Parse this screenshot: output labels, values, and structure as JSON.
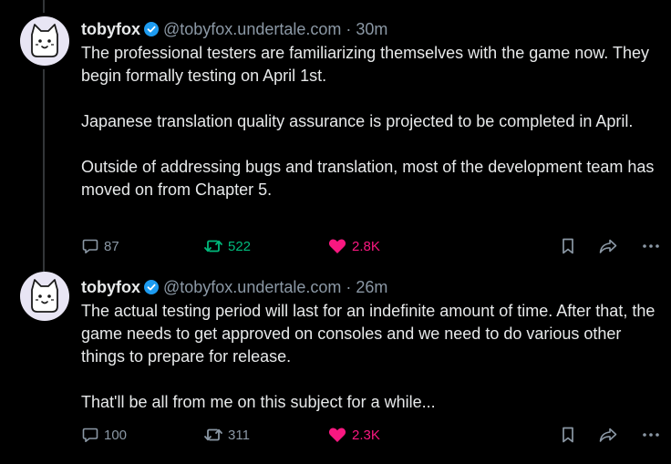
{
  "colors": {
    "background": "#000000",
    "text": "#e7e9ea",
    "muted": "#8b98a5",
    "verified": "#1d9bf0",
    "retweet_active": "#00ba7c",
    "like_active": "#f91880"
  },
  "posts": [
    {
      "author": {
        "name": "tobyfox",
        "handle": "@tobyfox.undertale.com",
        "verified": true,
        "avatar_icon": "white-dog-avatar-icon"
      },
      "separator": "·",
      "time": "30m",
      "text": "The professional testers are familiarizing themselves with the game now. They begin formally testing on April 1st.\n\nJapanese translation quality assurance is projected to be completed in April.\n\nOutside of addressing bugs and translation, most of the development team has moved on from Chapter 5.",
      "stats": {
        "replies": "87",
        "reposts": "522",
        "likes": "2.8K",
        "reposted": true,
        "liked": true
      }
    },
    {
      "author": {
        "name": "tobyfox",
        "handle": "@tobyfox.undertale.com",
        "verified": true,
        "avatar_icon": "white-dog-avatar-icon"
      },
      "separator": "·",
      "time": "26m",
      "text": "The actual testing period will last for an indefinite amount of time. After that, the game needs to get approved on consoles and we need to do various other things to prepare for release.\n\nThat'll be all from me on this subject for a while...",
      "stats": {
        "replies": "100",
        "reposts": "311",
        "likes": "2.3K",
        "reposted": false,
        "liked": true
      }
    }
  ]
}
